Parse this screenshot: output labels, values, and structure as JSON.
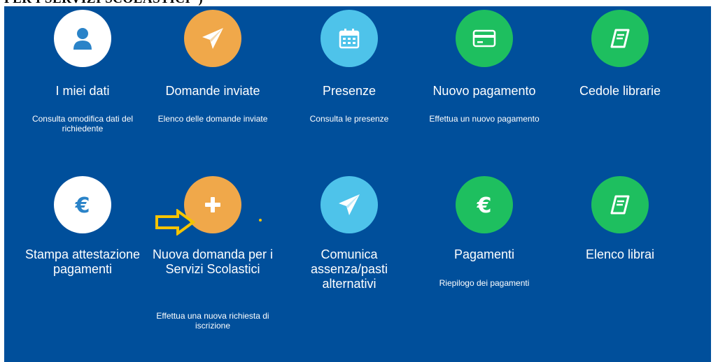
{
  "header": {
    "partial_text": "PER I SERVIZI SCOLASTICI\")"
  },
  "colors": {
    "panel": "#004f9b",
    "white": "#ffffff",
    "orange": "#f0a84a",
    "light_blue": "#4ec3ea",
    "green": "#1ebf5f",
    "arrow": "#f5c400"
  },
  "tiles": [
    {
      "icon": "user-icon",
      "title": "I miei dati",
      "desc": "Consulta omodifica dati del richiedente"
    },
    {
      "icon": "paper-plane-icon",
      "title": "Domande inviate",
      "desc": "Elenco delle domande inviate"
    },
    {
      "icon": "calendar-icon",
      "title": "Presenze",
      "desc": "Consulta le presenze"
    },
    {
      "icon": "credit-card-icon",
      "title": "Nuovo pagamento",
      "desc": "Effettua un nuovo pagamento"
    },
    {
      "icon": "book-icon",
      "title": "Cedole librarie",
      "desc": ""
    },
    {
      "icon": "euro-icon",
      "title": "Stampa attestazione pagamenti",
      "desc": ""
    },
    {
      "icon": "plus-icon",
      "title": "Nuova domanda per i Servizi Scolastici",
      "desc": "Effettua una nuova richiesta di iscrizione"
    },
    {
      "icon": "paper-plane-icon",
      "title": "Comunica assenza/pasti alternativi",
      "desc": ""
    },
    {
      "icon": "euro-icon",
      "title": "Pagamenti",
      "desc": "Riepilogo dei pagamenti"
    },
    {
      "icon": "book-icon",
      "title": "Elenco librai",
      "desc": ""
    }
  ]
}
